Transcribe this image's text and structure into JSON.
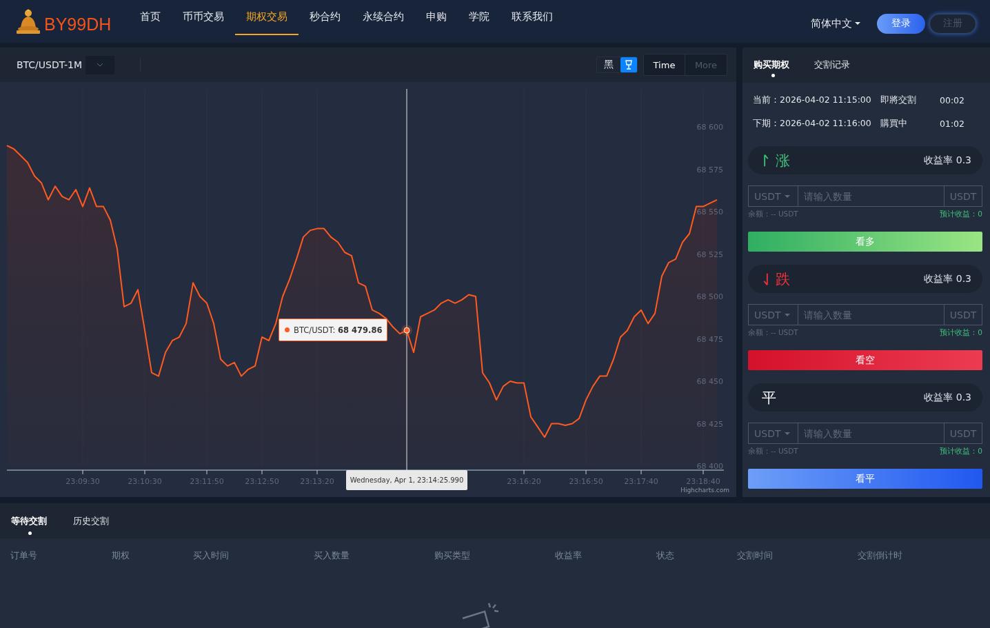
{
  "header": {
    "logo": "BY99DH",
    "nav": [
      {
        "label": "首页",
        "selected": false
      },
      {
        "label": "币币交易",
        "selected": false
      },
      {
        "label": "期权交易",
        "selected": true
      },
      {
        "label": "秒合约",
        "selected": false
      },
      {
        "label": "永续合约",
        "selected": false
      },
      {
        "label": "申购",
        "selected": false
      },
      {
        "label": "学院",
        "selected": false
      },
      {
        "label": "联系我们",
        "selected": false
      }
    ],
    "language": "简体中文",
    "login": "登录",
    "register": "注册"
  },
  "chart_panel": {
    "symbol": "BTC/USDT-1M",
    "theme_button": "黑",
    "ranges": [
      {
        "label": "Time",
        "selected": true
      },
      {
        "label": "More",
        "selected": false
      }
    ],
    "chart_data": {
      "type": "area",
      "categories": [
        null,
        null,
        null,
        null,
        null,
        null,
        null,
        null,
        null,
        null,
        null,
        "23:09:30",
        null,
        null,
        null,
        null,
        null,
        null,
        null,
        null,
        "23:10:30",
        null,
        null,
        null,
        null,
        null,
        null,
        null,
        null,
        "23:11:50",
        null,
        null,
        null,
        null,
        null,
        null,
        null,
        "23:12:50",
        null,
        null,
        null,
        null,
        null,
        null,
        null,
        "23:13:20",
        null,
        null,
        null,
        null,
        null,
        null,
        null,
        null,
        null,
        null,
        null,
        null,
        null,
        null,
        null,
        null,
        null,
        null,
        null,
        null,
        null,
        null,
        null,
        null,
        null,
        null,
        null,
        null,
        null,
        "23:16:20",
        null,
        null,
        null,
        null,
        null,
        null,
        null,
        null,
        "23:16:50",
        null,
        null,
        null,
        null,
        null,
        null,
        null,
        "23:17:40",
        null,
        null,
        null,
        null,
        null,
        null,
        null,
        null,
        "23:18:40",
        null,
        null
      ],
      "series": [
        {
          "name": "BTC/USDT",
          "color": "#ff5a1f",
          "values": [
            68589,
            68587,
            68583,
            68579,
            68571,
            68567,
            68557,
            68565,
            68559,
            68557,
            68563,
            68553,
            68564,
            68553,
            68553,
            68545,
            68528,
            68494,
            68496,
            68504,
            68480,
            68455,
            68453,
            68467,
            68474,
            68476,
            68484,
            68508,
            68500,
            68496,
            68484,
            68463,
            68459,
            68461,
            68453,
            68457,
            68459,
            68476,
            68474,
            68484,
            68500,
            68510,
            68522,
            68535,
            68539,
            68540,
            68540,
            68535,
            68532,
            68526,
            68524,
            68508,
            68506,
            68492,
            68490,
            68487,
            68482,
            68478,
            68480,
            68467,
            68488,
            68490,
            68492,
            68496,
            68498,
            68496,
            68498,
            68501,
            68500,
            68455,
            68449,
            68439,
            68447,
            68450,
            68449,
            68449,
            68429,
            68423,
            68417,
            68425,
            68425,
            68424,
            68425,
            68428,
            68439,
            68447,
            68453,
            68453,
            68463,
            68476,
            68480,
            68488,
            68492,
            68484,
            68490,
            68512,
            68520,
            68522,
            68532,
            68537,
            68553,
            68553,
            68555,
            68557
          ]
        }
      ],
      "ylim": [
        68400,
        68600
      ],
      "yticks": [
        {
          "value": 68400,
          "label": "68 400"
        },
        {
          "value": 68425,
          "label": "68 425"
        },
        {
          "value": 68450,
          "label": "68 450"
        },
        {
          "value": 68475,
          "label": "68 475"
        },
        {
          "value": 68500,
          "label": "68 500"
        },
        {
          "value": 68525,
          "label": "68 525"
        },
        {
          "value": 68550,
          "label": "68 550"
        },
        {
          "value": 68575,
          "label": "68 575"
        },
        {
          "value": 68600,
          "label": "68 600"
        }
      ]
    },
    "tooltip": {
      "separator": ": ",
      "value": "68 479.86",
      "time": "Wednesday, Apr 1, 23:14:25.990"
    },
    "credit": "Highcharts.com"
  },
  "order_panel": {
    "tabs": [
      {
        "label": "购买期权",
        "selected": true
      },
      {
        "label": "交割记录",
        "selected": false
      }
    ],
    "periods": [
      {
        "label": "当前：2026-04-02 11:15:00",
        "status": "即將交割",
        "countdown": "00:02"
      },
      {
        "label": "下期：2026-04-02 11:16:00",
        "status": "購買中",
        "countdown": "01:02"
      }
    ],
    "options": [
      {
        "kind": "up",
        "direction": "涨",
        "rate": "收益率 0.3",
        "currency": "USDT",
        "placeholder": "请输入数量",
        "unit": "USDT",
        "balance": "余额：-- USDT",
        "profit": "预计收益：0",
        "button": "看多"
      },
      {
        "kind": "down",
        "direction": "跌",
        "rate": "收益率 0.3",
        "currency": "USDT",
        "placeholder": "请输入数量",
        "unit": "USDT",
        "balance": "余额：-- USDT",
        "profit": "预计收益：0",
        "button": "看空"
      },
      {
        "kind": "flat",
        "direction": "平",
        "rate": "收益率 0.3",
        "currency": "USDT",
        "placeholder": "请输入数量",
        "unit": "USDT",
        "balance": "余额：-- USDT",
        "profit": "预计收益：0",
        "button": "看平"
      }
    ]
  },
  "orders": {
    "tabs": [
      {
        "label": "等待交割",
        "selected": true
      },
      {
        "label": "历史交割",
        "selected": false
      }
    ],
    "columns": [
      "订单号",
      "期权",
      "买入时间",
      "买入数量",
      "购买类型",
      "收益率",
      "状态",
      "交割时间",
      "交割倒计时"
    ]
  }
}
